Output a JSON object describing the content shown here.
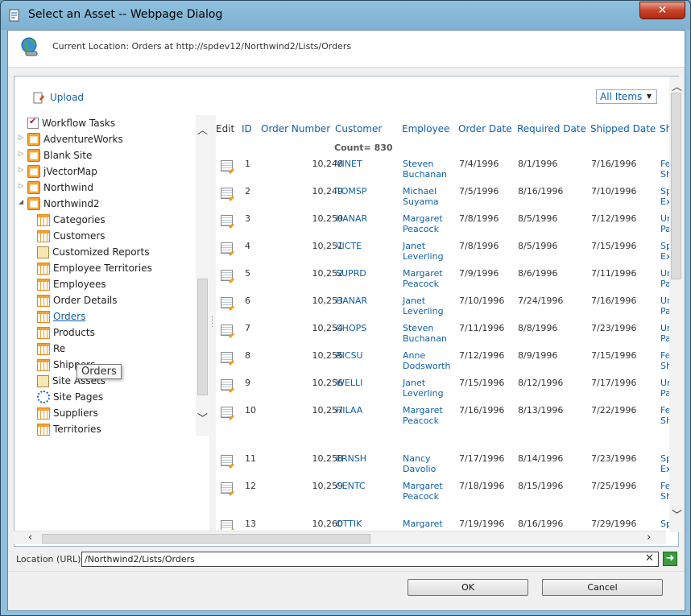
{
  "window": {
    "title": "Select an Asset -- Webpage Dialog",
    "close_label": "✕"
  },
  "header": {
    "current_location": "Current Location: Orders at http://spdev12/Northwind2/Lists/Orders"
  },
  "toolbar": {
    "upload_label": "Upload",
    "view_selected": "All Items"
  },
  "tree": {
    "items": [
      {
        "label": "Workflow Tasks",
        "icon": "task-list-icon"
      },
      {
        "label": "AdventureWorks",
        "icon": "site-icon"
      },
      {
        "label": "Blank Site",
        "icon": "site-icon"
      },
      {
        "label": "jVectorMap",
        "icon": "site-icon"
      },
      {
        "label": "Northwind",
        "icon": "site-icon"
      },
      {
        "label": "Northwind2",
        "icon": "site-icon"
      },
      {
        "label": "Categories",
        "icon": "list-icon"
      },
      {
        "label": "Customers",
        "icon": "list-icon"
      },
      {
        "label": "Customized Reports",
        "icon": "doc-library-icon"
      },
      {
        "label": "Employee Territories",
        "icon": "list-icon"
      },
      {
        "label": "Employees",
        "icon": "list-icon"
      },
      {
        "label": "Order Details",
        "icon": "list-icon"
      },
      {
        "label": "Orders",
        "icon": "list-icon"
      },
      {
        "label": "Products",
        "icon": "list-icon"
      },
      {
        "label": "Re",
        "icon": "list-icon"
      },
      {
        "label": "Shippers",
        "icon": "list-icon"
      },
      {
        "label": "Site Assets",
        "icon": "doc-library-icon"
      },
      {
        "label": "Site Pages",
        "icon": "site-pages-icon"
      },
      {
        "label": "Suppliers",
        "icon": "list-icon"
      },
      {
        "label": "Territories",
        "icon": "list-icon"
      }
    ],
    "tooltip": "Orders"
  },
  "grid": {
    "columns": [
      "Edit",
      "ID",
      "Order Number",
      "Customer",
      "Employee",
      "Order Date",
      "Required Date",
      "Shipped Date",
      "Shi"
    ],
    "count_label": "Count= 830",
    "rows": [
      {
        "id": "1",
        "order": "10,248",
        "customer": "VINET",
        "emp1": "Steven",
        "emp2": "Buchanan",
        "odate": "7/4/1996",
        "rdate": "8/1/1996",
        "sdate": "7/16/1996",
        "ship1": "Fed",
        "ship2": "Sh"
      },
      {
        "id": "2",
        "order": "10,249",
        "customer": "TOMSP",
        "emp1": "Michael",
        "emp2": "Suyama",
        "odate": "7/5/1996",
        "rdate": "8/16/1996",
        "sdate": "7/10/1996",
        "ship1": "Sp",
        "ship2": "Exp"
      },
      {
        "id": "3",
        "order": "10,250",
        "customer": "HANAR",
        "emp1": "Margaret",
        "emp2": "Peacock",
        "odate": "7/8/1996",
        "rdate": "8/5/1996",
        "sdate": "7/12/1996",
        "ship1": "Un",
        "ship2": "Pac"
      },
      {
        "id": "4",
        "order": "10,251",
        "customer": "VICTE",
        "emp1": "Janet",
        "emp2": "Leverling",
        "odate": "7/8/1996",
        "rdate": "8/5/1996",
        "sdate": "7/15/1996",
        "ship1": "Sp",
        "ship2": "Exp"
      },
      {
        "id": "5",
        "order": "10,252",
        "customer": "SUPRD",
        "emp1": "Margaret",
        "emp2": "Peacock",
        "odate": "7/9/1996",
        "rdate": "8/6/1996",
        "sdate": "7/11/1996",
        "ship1": "Un",
        "ship2": "Pac"
      },
      {
        "id": "6",
        "order": "10,253",
        "customer": "HANAR",
        "emp1": "Janet",
        "emp2": "Leverling",
        "odate": "7/10/1996",
        "rdate": "7/24/1996",
        "sdate": "7/16/1996",
        "ship1": "Un",
        "ship2": "Pac"
      },
      {
        "id": "7",
        "order": "10,254",
        "customer": "CHOPS",
        "emp1": "Steven",
        "emp2": "Buchanan",
        "odate": "7/11/1996",
        "rdate": "8/8/1996",
        "sdate": "7/23/1996",
        "ship1": "Un",
        "ship2": "Pac"
      },
      {
        "id": "8",
        "order": "10,255",
        "customer": "RICSU",
        "emp1": "Anne",
        "emp2": "Dodsworth",
        "odate": "7/12/1996",
        "rdate": "8/9/1996",
        "sdate": "7/15/1996",
        "ship1": "Fed",
        "ship2": "Sh"
      },
      {
        "id": "9",
        "order": "10,256",
        "customer": "WELLI",
        "emp1": "Janet",
        "emp2": "Leverling",
        "odate": "7/15/1996",
        "rdate": "8/12/1996",
        "sdate": "7/17/1996",
        "ship1": "Un",
        "ship2": "Pac"
      },
      {
        "id": "10",
        "order": "10,257",
        "customer": "HILAA",
        "emp1": "Margaret",
        "emp2": "Peacock",
        "odate": "7/16/1996",
        "rdate": "8/13/1996",
        "sdate": "7/22/1996",
        "ship1": "Fed",
        "ship2": "Sh"
      },
      {
        "id": "11",
        "order": "10,258",
        "customer": "ERNSH",
        "emp1": "Nancy",
        "emp2": "Davolio",
        "odate": "7/17/1996",
        "rdate": "8/14/1996",
        "sdate": "7/23/1996",
        "ship1": "Sp",
        "ship2": "Exp"
      },
      {
        "id": "12",
        "order": "10,259",
        "customer": "CENTC",
        "emp1": "Margaret",
        "emp2": "Peacock",
        "odate": "7/18/1996",
        "rdate": "8/15/1996",
        "sdate": "7/25/1996",
        "ship1": "Fed",
        "ship2": "Sh"
      },
      {
        "id": "13",
        "order": "10,260",
        "customer": "OTTIK",
        "emp1": "Margaret",
        "emp2": "Peacock",
        "odate": "7/19/1996",
        "rdate": "8/16/1996",
        "sdate": "7/29/1996",
        "ship1": "Sp",
        "ship2": ""
      }
    ]
  },
  "location": {
    "label": "Location (URL):",
    "value": "/Northwind2/Lists/Orders",
    "clear_label": "✕",
    "go_label": "➜"
  },
  "buttons": {
    "ok_label": "OK",
    "cancel_label": "Cancel"
  }
}
